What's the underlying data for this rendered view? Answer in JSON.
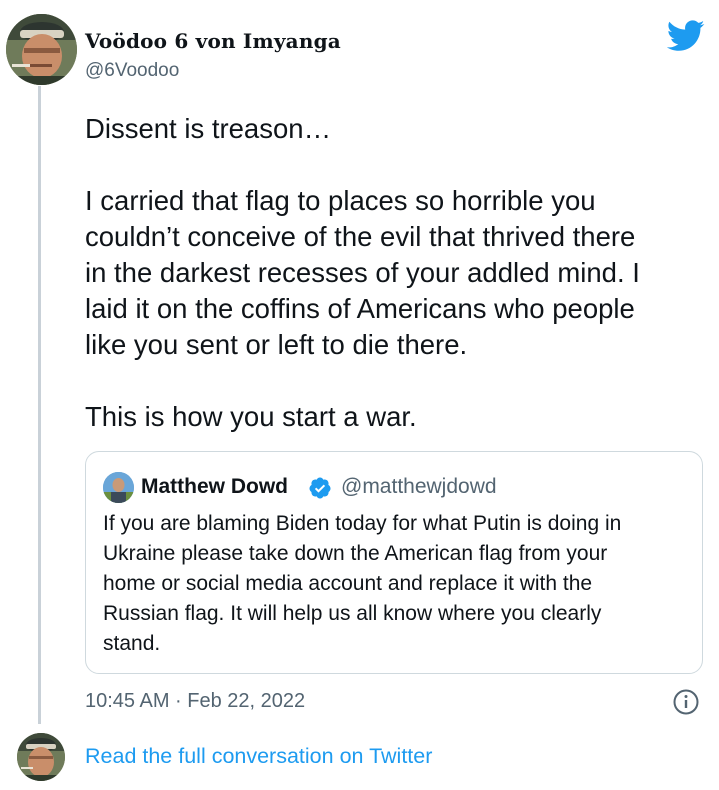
{
  "author": {
    "display_name": "Voödoo 6 von Imyanga",
    "handle": "@6Voodoo"
  },
  "tweet": {
    "lines": [
      "Dissent is treason…",
      "",
      "I carried that flag to places so horrible you",
      "couldn’t conceive of the evil that thrived there",
      "in the darkest recesses of your addled mind. I",
      "laid it on the coffins of Americans who people",
      "like you sent or left to die there.",
      "",
      "This is how you start a war."
    ],
    "timestamp": "10:45 AM · Feb 22, 2022"
  },
  "quote": {
    "display_name": "Matthew Dowd",
    "handle": "@matthewjdowd",
    "verified": true,
    "lines": [
      "If you are blaming Biden today for what Putin is doing in",
      "Ukraine please take down the American flag from your",
      "home or social media account and replace it with the",
      "Russian flag. It will help us all know where you clearly",
      "stand."
    ]
  },
  "footer": {
    "read_more_label": "Read the full conversation on Twitter"
  },
  "icons": {
    "brand": "twitter-bird-icon",
    "verified": "verified-badge-icon",
    "info": "info-icon"
  },
  "colors": {
    "link": "#1d9bf0",
    "text": "#0f1419",
    "secondary": "#536471",
    "border": "#cfd9de",
    "thread_line": "#c9d1d8"
  }
}
